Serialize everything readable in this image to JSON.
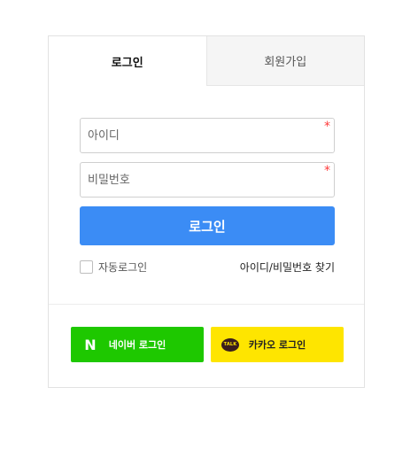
{
  "tabs": {
    "login": "로그인",
    "signup": "회원가입"
  },
  "form": {
    "id_placeholder": "아이디",
    "password_placeholder": "비밀번호",
    "required_mark": "*",
    "login_button": "로그인",
    "auto_login": "자동로그인",
    "find_link": "아이디/비밀번호 찾기"
  },
  "social": {
    "naver_label": "네이버 로그인",
    "naver_icon_text": "N",
    "kakao_label": "카카오 로그인",
    "kakao_icon_text": "TALK"
  },
  "colors": {
    "primary": "#3b8cf5",
    "naver": "#1ec800",
    "kakao": "#fee500",
    "required": "#ff3b3b"
  }
}
